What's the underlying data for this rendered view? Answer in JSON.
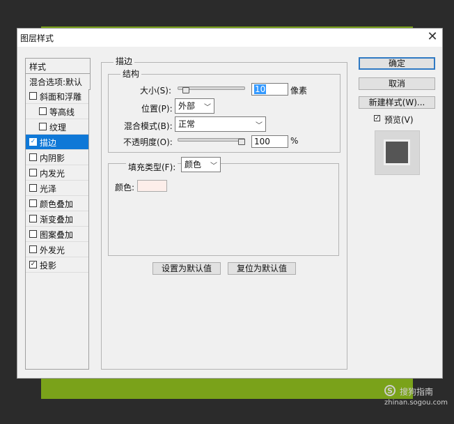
{
  "dialog": {
    "title": "图层样式"
  },
  "left_panel": {
    "header": "样式",
    "blend_options": "混合选项:默认",
    "items": [
      {
        "label": "斜面和浮雕",
        "checked": false,
        "indent": false
      },
      {
        "label": "等高线",
        "checked": false,
        "indent": true
      },
      {
        "label": "纹理",
        "checked": false,
        "indent": true
      },
      {
        "label": "描边",
        "checked": true,
        "indent": false,
        "selected": true
      },
      {
        "label": "内阴影",
        "checked": false,
        "indent": false
      },
      {
        "label": "内发光",
        "checked": false,
        "indent": false
      },
      {
        "label": "光泽",
        "checked": false,
        "indent": false
      },
      {
        "label": "颜色叠加",
        "checked": false,
        "indent": false
      },
      {
        "label": "渐变叠加",
        "checked": false,
        "indent": false
      },
      {
        "label": "图案叠加",
        "checked": false,
        "indent": false
      },
      {
        "label": "外发光",
        "checked": false,
        "indent": false
      },
      {
        "label": "投影",
        "checked": true,
        "indent": false
      }
    ]
  },
  "stroke": {
    "section_title": "描边",
    "structure_title": "结构",
    "size_label": "大小(S):",
    "size_value": "10",
    "size_unit": "像素",
    "size_slider_fraction": 0.08,
    "position_label": "位置(P):",
    "position_value": "外部",
    "blend_mode_label": "混合模式(B):",
    "blend_mode_value": "正常",
    "opacity_label": "不透明度(O):",
    "opacity_value": "100",
    "opacity_unit": "%",
    "opacity_slider_fraction": 1.0,
    "fill_type_label": "填充类型(F):",
    "fill_type_value": "颜色",
    "color_label": "颜色:",
    "color_swatch": "#fdeeea",
    "set_default_button": "设置为默认值",
    "reset_default_button": "复位为默认值"
  },
  "right_panel": {
    "ok_button": "确定",
    "cancel_button": "取消",
    "new_style_button": "新建样式(W)...",
    "preview_label": "预览(V)",
    "preview_checked": true
  },
  "watermark": {
    "brand": "搜狗指南",
    "url": "zhinan.sogou.com"
  }
}
